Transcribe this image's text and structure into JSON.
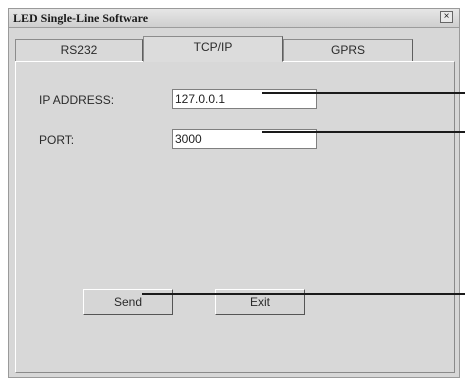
{
  "window": {
    "title": "LED Single-Line Software",
    "close_symbol": "×"
  },
  "tabs": [
    {
      "label": "RS232"
    },
    {
      "label": "TCP/IP",
      "selected": true
    },
    {
      "label": "GPRS"
    }
  ],
  "form": {
    "ip_label": "IP ADDRESS:",
    "ip_value": "127.0.0.1",
    "port_label": "PORT:",
    "port_value": "3000"
  },
  "buttons": {
    "send": "Send",
    "exit": "Exit"
  },
  "colors": {
    "window_bg": "#d7d7d7",
    "callout_line": "#1a1a1a"
  }
}
